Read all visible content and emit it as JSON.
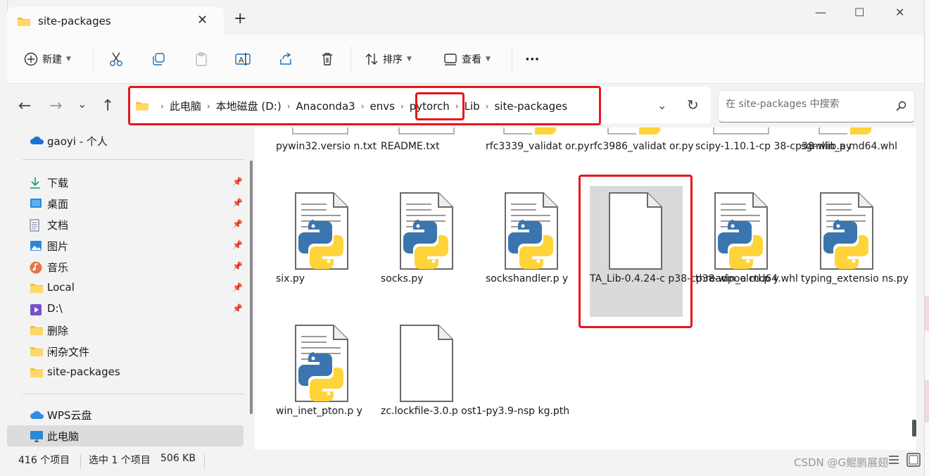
{
  "window": {
    "tab_title": "site-packages",
    "tab_close": "✕",
    "new_tab": "+",
    "minimize": "—",
    "maximize": "☐",
    "close": "✕"
  },
  "toolbar": {
    "new_label": "新建",
    "sort_label": "排序",
    "view_label": "查看",
    "more_label": "···"
  },
  "address": {
    "crumbs": [
      "此电脑",
      "本地磁盘 (D:)",
      "Anaconda3",
      "envs",
      "pytorch",
      "Lib",
      "site-packages"
    ],
    "search_placeholder": "在 site-packages 中搜索"
  },
  "sidebar": {
    "onedrive": "gaoyi - 个人",
    "quick": [
      {
        "label": "下载",
        "icon": "download-icon"
      },
      {
        "label": "桌面",
        "icon": "desktop-icon"
      },
      {
        "label": "文档",
        "icon": "document-icon"
      },
      {
        "label": "图片",
        "icon": "pictures-icon"
      },
      {
        "label": "音乐",
        "icon": "music-icon"
      },
      {
        "label": "Local",
        "icon": "folder-icon"
      },
      {
        "label": "D:\\",
        "icon": "video-icon"
      },
      {
        "label": "删除",
        "icon": "folder-icon"
      },
      {
        "label": "闲杂文件",
        "icon": "folder-icon"
      },
      {
        "label": "site-packages",
        "icon": "folder-icon"
      }
    ],
    "wps": "WPS云盘",
    "thispc": "此电脑"
  },
  "files_row0": [
    {
      "name": "pywin32.versio\nn.txt",
      "type": "text"
    },
    {
      "name": "README.txt",
      "type": "text"
    },
    {
      "name": "rfc3339_validat\nor.py",
      "type": "python"
    },
    {
      "name": "rfc3986_validat\nor.py",
      "type": "python"
    },
    {
      "name": "scipy-1.10.1-cp\n38-cp38-win_a\nmd64.whl",
      "type": "text"
    },
    {
      "name": "sgmllib.py",
      "type": "python"
    }
  ],
  "files_row1": [
    {
      "name": "six.py",
      "type": "python"
    },
    {
      "name": "socks.py",
      "type": "python"
    },
    {
      "name": "sockshandler.p\ny",
      "type": "python"
    },
    {
      "name": "TA_Lib-0.4.24-c\np38-cp38-win_a\nmd64.whl",
      "type": "blank"
    },
    {
      "name": "threadpoolctl.p\ny",
      "type": "python"
    },
    {
      "name": "typing_extensio\nns.py",
      "type": "python"
    }
  ],
  "files_row2": [
    {
      "name": "win_inet_pton.p\ny",
      "type": "python"
    },
    {
      "name": "zc.lockfile-3.0.p\nost1-py3.9-nsp\nkg.pth",
      "type": "blank"
    }
  ],
  "status": {
    "count": "416 个项目",
    "selected": "选中 1 个项目",
    "size": "506 KB"
  },
  "watermark": "CSDN @G鲲鹏展翅",
  "colors": {
    "annotation_red": "#e8141b",
    "folder_yellow": "#f4c242",
    "python_blue": "#3a75b0",
    "python_yellow": "#ffd43b"
  }
}
